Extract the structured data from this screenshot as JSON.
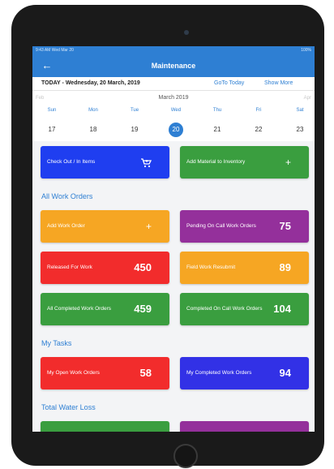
{
  "statusbar": {
    "left": "9:43 AM   Wed Mar 20",
    "right": "100%"
  },
  "header": {
    "title": "Maintenance",
    "back_icon": "back-arrow-icon"
  },
  "datebar": {
    "today": "TODAY - Wednesday, 20 March, 2019",
    "goto_today": "GoTo Today",
    "show_more": "Show More"
  },
  "calendar": {
    "month": "March 2019",
    "prev_month": "Feb",
    "next_month": "Apr",
    "days": [
      {
        "weekday": "Sun",
        "date": "17"
      },
      {
        "weekday": "Mon",
        "date": "18"
      },
      {
        "weekday": "Tue",
        "date": "19"
      },
      {
        "weekday": "Wed",
        "date": "20"
      },
      {
        "weekday": "Thu",
        "date": "21"
      },
      {
        "weekday": "Fri",
        "date": "22"
      },
      {
        "weekday": "Sat",
        "date": "23"
      }
    ],
    "selected_date": "20"
  },
  "actions": {
    "checkout": {
      "label": "Check Out / In Items",
      "icon": "cart-icon",
      "color": "#1f3ef0"
    },
    "add_material": {
      "label": "Add Material to Inventory",
      "icon": "plus-icon",
      "color": "#3a9e3f"
    }
  },
  "sections": {
    "all_work_orders": "All Work Orders",
    "my_tasks": "My Tasks",
    "total_water_loss": "Total Water Loss"
  },
  "work_orders": [
    {
      "label": "Add Work Order",
      "icon": "plus-icon",
      "color": "#f6a623"
    },
    {
      "label": "Pending On Call Work Orders",
      "count": "75",
      "color": "#94309b"
    },
    {
      "label": "Released For Work",
      "count": "450",
      "color": "#f22c2c"
    },
    {
      "label": "Field Work Resubmit",
      "count": "89",
      "color": "#f6a623"
    },
    {
      "label": "All Completed Work Orders",
      "count": "459",
      "color": "#3a9e3f"
    },
    {
      "label": "Completed On Call Work Orders",
      "count": "104",
      "color": "#3a9e3f"
    }
  ],
  "tasks": [
    {
      "label": "My Open Work Orders",
      "count": "58",
      "color": "#f22c2c"
    },
    {
      "label": "My Completed Work Orders",
      "count": "94",
      "color": "#3231e6"
    }
  ],
  "water_loss_colors": [
    "#3a9e3f",
    "#94309b"
  ]
}
